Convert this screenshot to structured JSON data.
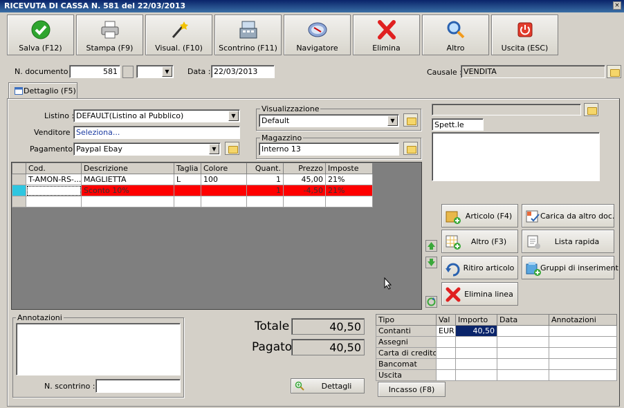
{
  "window": {
    "title": "RICEVUTA DI CASSA N. 581 del 22/03/2013",
    "close": "×"
  },
  "toolbar": [
    {
      "label": "Salva (F12)",
      "icon": "check-icon"
    },
    {
      "label": "Stampa (F9)",
      "icon": "printer-icon"
    },
    {
      "label": "Visual. (F10)",
      "icon": "magic-wand-icon"
    },
    {
      "label": "Scontrino (F11)",
      "icon": "cash-register-icon"
    },
    {
      "label": "Navigatore",
      "icon": "compass-icon"
    },
    {
      "label": "Elimina",
      "icon": "delete-x-icon"
    },
    {
      "label": "Altro",
      "icon": "magnifier-icon"
    },
    {
      "label": "Uscita (ESC)",
      "icon": "power-icon"
    }
  ],
  "header": {
    "doc_label": "N. documento :",
    "doc_value": "581",
    "data_label": "Data :",
    "data_value": "22/03/2013",
    "causale_label": "Causale :",
    "causale_value": "VENDITA"
  },
  "tab": {
    "label": "Dettaglio (F5)"
  },
  "form": {
    "listino_label": "Listino :",
    "listino_value": "DEFAULT(Listino al Pubblico)",
    "venditore_label": "Venditore :",
    "venditore_value": "Seleziona...",
    "pagamento_label": "Pagamento :",
    "pagamento_value": "Paypal Ebay",
    "visualizzazione_title": "Visualizzazione",
    "visualizzazione_value": "Default",
    "magazzino_title": "Magazzino",
    "magazzino_value": "Interno 13"
  },
  "customer": {
    "name": "Spett.le"
  },
  "grid": {
    "columns": [
      "Cod.",
      "Descrizione",
      "Taglia",
      "Colore",
      "Quant.",
      "Prezzo",
      "Imposte"
    ],
    "rows": [
      [
        "T-AMON-RS-...",
        "MAGLIETTA",
        "L",
        "100",
        "1",
        "45,00",
        "21%"
      ],
      [
        "",
        "Sconto 10%",
        "",
        "",
        "1",
        "-4,50",
        "21%"
      ],
      [
        "",
        "",
        "",
        "",
        "",
        "",
        ""
      ]
    ],
    "highlight_color": "#ff0000"
  },
  "side_buttons": {
    "articolo": "Articolo (F4)",
    "carica": "Carica da altro doc.",
    "altro": "Altro (F3)",
    "lista": "Lista rapida",
    "ritiro": "Ritiro articolo",
    "gruppi": "Gruppi di inseriment",
    "elimina": "Elimina linea"
  },
  "annotazioni": {
    "title": "Annotazioni",
    "scontrino_label": "N. scontrino :"
  },
  "totals": {
    "totale_label": "Totale",
    "totale_value": "40,50",
    "pagato_label": "Pagato",
    "pagato_value": "40,50",
    "dettagli_label": "Dettagli"
  },
  "payments": {
    "columns": [
      "Tipo",
      "Val",
      "Importo",
      "Data",
      "Annotazioni"
    ],
    "rows": [
      [
        "Contanti",
        "EUR",
        "40,50",
        "",
        ""
      ],
      [
        "Assegni",
        "",
        "",
        "",
        ""
      ],
      [
        "Carta di credito",
        "",
        "",
        "",
        ""
      ],
      [
        "Bancomat",
        "",
        "",
        "",
        ""
      ],
      [
        "Uscita",
        "",
        "",
        "",
        ""
      ]
    ],
    "incasso_label": "Incasso (F8)"
  }
}
